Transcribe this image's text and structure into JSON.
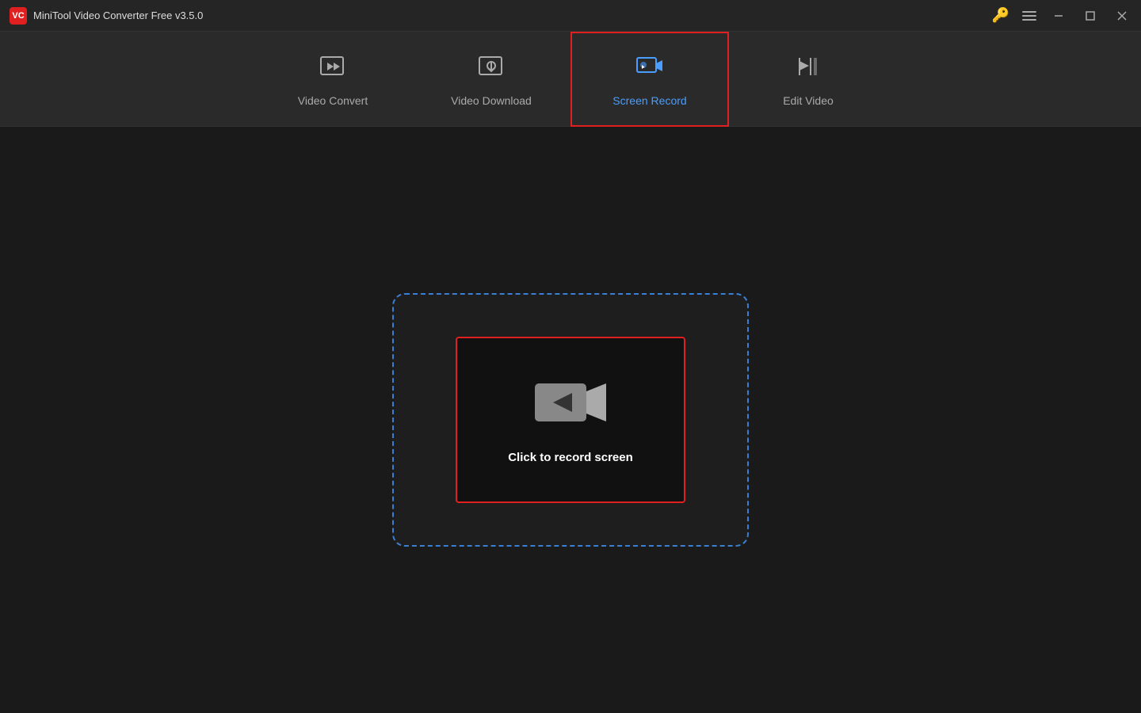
{
  "titlebar": {
    "app_name": "MiniTool Video Converter Free v3.5.0",
    "logo_text": "VC"
  },
  "nav": {
    "tabs": [
      {
        "id": "video-convert",
        "label": "Video Convert",
        "active": false
      },
      {
        "id": "video-download",
        "label": "Video Download",
        "active": false
      },
      {
        "id": "screen-record",
        "label": "Screen Record",
        "active": true
      },
      {
        "id": "edit-video",
        "label": "Edit Video",
        "active": false
      }
    ]
  },
  "main": {
    "record_button_label": "Click to record screen"
  },
  "colors": {
    "active_tab_text": "#4a9eff",
    "active_tab_border": "#e02020",
    "record_border": "#e02020",
    "dashed_border": "#3a7fd4",
    "key_icon": "#f0c040"
  }
}
